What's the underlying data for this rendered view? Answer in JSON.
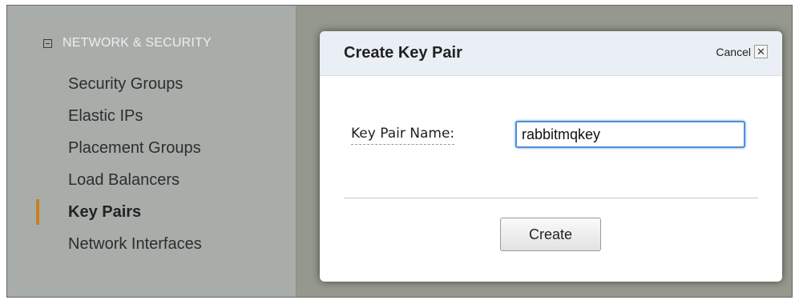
{
  "sidebar": {
    "section_header": "NETWORK & SECURITY",
    "items": [
      {
        "label": "Security Groups"
      },
      {
        "label": "Elastic IPs"
      },
      {
        "label": "Placement Groups"
      },
      {
        "label": "Load Balancers"
      },
      {
        "label": "Key Pairs",
        "active": true
      },
      {
        "label": "Network Interfaces"
      }
    ]
  },
  "dialog": {
    "title": "Create Key Pair",
    "cancel_label": "Cancel",
    "close_glyph": "✕",
    "field_label": "Key Pair Name:",
    "field_value": "rabbitmqkey",
    "create_label": "Create"
  },
  "colors": {
    "active_marker": "#c87f20",
    "input_focus": "#4d90d6",
    "dialog_header_bg": "#e9eff5"
  }
}
